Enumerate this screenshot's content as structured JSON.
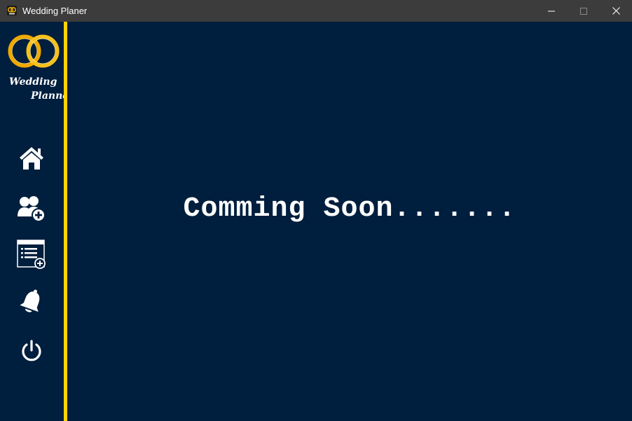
{
  "window": {
    "title": "Wedding Planer"
  },
  "titlebar": {
    "icons": [
      "app-icon",
      "minimize-icon",
      "maximize-icon",
      "close-icon"
    ]
  },
  "sidebar": {
    "logo": {
      "line1": "Wedding",
      "line2": "Planner"
    },
    "items": [
      {
        "icon": "home-icon"
      },
      {
        "icon": "add-user-icon"
      },
      {
        "icon": "add-list-icon"
      },
      {
        "icon": "bell-icon"
      },
      {
        "icon": "power-icon"
      }
    ]
  },
  "main": {
    "message": "Comming Soon......."
  },
  "colors": {
    "background": "#001e3d",
    "accent": "#ffd200",
    "titlebar": "#3c3c3c",
    "text": "#ffffff"
  }
}
